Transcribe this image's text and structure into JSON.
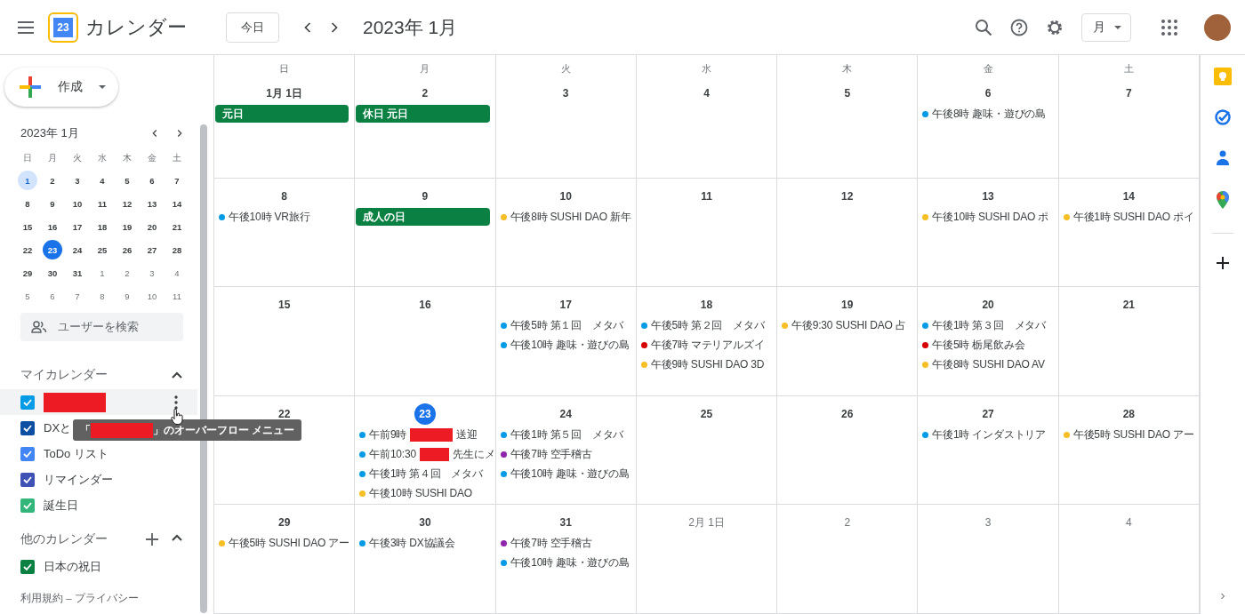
{
  "header": {
    "logo_day": "23",
    "app_name": "カレンダー",
    "today_button": "今日",
    "period": "2023年 1月",
    "view_select": "月"
  },
  "sidebar": {
    "create_label": "作成",
    "mini_calendar": {
      "title": "2023年 1月",
      "weekdays": [
        "日",
        "月",
        "火",
        "水",
        "木",
        "金",
        "土"
      ],
      "weeks": [
        [
          {
            "day": "1",
            "other_month": false,
            "selected": false,
            "highlighted": true
          },
          {
            "day": "2",
            "other_month": false,
            "selected": false,
            "highlighted": false
          },
          {
            "day": "3",
            "other_month": false,
            "selected": false,
            "highlighted": false
          },
          {
            "day": "4",
            "other_month": false,
            "selected": false,
            "highlighted": false
          },
          {
            "day": "5",
            "other_month": false,
            "selected": false,
            "highlighted": false
          },
          {
            "day": "6",
            "other_month": false,
            "selected": false,
            "highlighted": false
          },
          {
            "day": "7",
            "other_month": false,
            "selected": false,
            "highlighted": false
          }
        ],
        [
          {
            "day": "8",
            "other_month": false,
            "selected": false,
            "highlighted": false
          },
          {
            "day": "9",
            "other_month": false,
            "selected": false,
            "highlighted": false
          },
          {
            "day": "10",
            "other_month": false,
            "selected": false,
            "highlighted": false
          },
          {
            "day": "11",
            "other_month": false,
            "selected": false,
            "highlighted": false
          },
          {
            "day": "12",
            "other_month": false,
            "selected": false,
            "highlighted": false
          },
          {
            "day": "13",
            "other_month": false,
            "selected": false,
            "highlighted": false
          },
          {
            "day": "14",
            "other_month": false,
            "selected": false,
            "highlighted": false
          }
        ],
        [
          {
            "day": "15",
            "other_month": false,
            "selected": false,
            "highlighted": false
          },
          {
            "day": "16",
            "other_month": false,
            "selected": false,
            "highlighted": false
          },
          {
            "day": "17",
            "other_month": false,
            "selected": false,
            "highlighted": false
          },
          {
            "day": "18",
            "other_month": false,
            "selected": false,
            "highlighted": false
          },
          {
            "day": "19",
            "other_month": false,
            "selected": false,
            "highlighted": false
          },
          {
            "day": "20",
            "other_month": false,
            "selected": false,
            "highlighted": false
          },
          {
            "day": "21",
            "other_month": false,
            "selected": false,
            "highlighted": false
          }
        ],
        [
          {
            "day": "22",
            "other_month": false,
            "selected": false,
            "highlighted": false
          },
          {
            "day": "23",
            "other_month": false,
            "selected": true,
            "highlighted": false
          },
          {
            "day": "24",
            "other_month": false,
            "selected": false,
            "highlighted": false
          },
          {
            "day": "25",
            "other_month": false,
            "selected": false,
            "highlighted": false
          },
          {
            "day": "26",
            "other_month": false,
            "selected": false,
            "highlighted": false
          },
          {
            "day": "27",
            "other_month": false,
            "selected": false,
            "highlighted": false
          },
          {
            "day": "28",
            "other_month": false,
            "selected": false,
            "highlighted": false
          }
        ],
        [
          {
            "day": "29",
            "other_month": false,
            "selected": false,
            "highlighted": false
          },
          {
            "day": "30",
            "other_month": false,
            "selected": false,
            "highlighted": false
          },
          {
            "day": "31",
            "other_month": false,
            "selected": false,
            "highlighted": false
          },
          {
            "day": "1",
            "other_month": true,
            "selected": false,
            "highlighted": false
          },
          {
            "day": "2",
            "other_month": true,
            "selected": false,
            "highlighted": false
          },
          {
            "day": "3",
            "other_month": true,
            "selected": false,
            "highlighted": false
          },
          {
            "day": "4",
            "other_month": true,
            "selected": false,
            "highlighted": false
          }
        ],
        [
          {
            "day": "5",
            "other_month": true,
            "selected": false,
            "highlighted": false
          },
          {
            "day": "6",
            "other_month": true,
            "selected": false,
            "highlighted": false
          },
          {
            "day": "7",
            "other_month": true,
            "selected": false,
            "highlighted": false
          },
          {
            "day": "8",
            "other_month": true,
            "selected": false,
            "highlighted": false
          },
          {
            "day": "9",
            "other_month": true,
            "selected": false,
            "highlighted": false
          },
          {
            "day": "10",
            "other_month": true,
            "selected": false,
            "highlighted": false
          },
          {
            "day": "11",
            "other_month": true,
            "selected": false,
            "highlighted": false
          }
        ]
      ]
    },
    "user_search": {
      "placeholder": "ユーザーを検索"
    },
    "my_calendars": {
      "title": "マイカレンダー",
      "items": [
        {
          "redacted": true,
          "checked": true,
          "color": "#039be5",
          "hovered": true
        },
        {
          "label": "DXと",
          "checked": true,
          "color": "#0b4ea2",
          "hovered": false
        },
        {
          "label": "ToDo リスト",
          "checked": true,
          "color": "#4285f4",
          "hovered": false
        },
        {
          "label": "リマインダー",
          "checked": true,
          "color": "#3f51b5",
          "hovered": false
        },
        {
          "label": "誕生日",
          "checked": true,
          "color": "#33b679",
          "hovered": false
        }
      ]
    },
    "other_calendars": {
      "title": "他のカレンダー",
      "items": [
        {
          "label": "日本の祝日",
          "checked": true,
          "color": "#0b8043",
          "hovered": false
        }
      ]
    },
    "tooltip": {
      "before": "「",
      "after": "」のオーバーフロー メニュー"
    },
    "footer": "利用規約 – プライバシー"
  },
  "month": {
    "weekdays": [
      "日",
      "月",
      "火",
      "水",
      "木",
      "金",
      "土"
    ],
    "days": [
      {
        "date": "1月 1日",
        "muted": false,
        "today": false,
        "events": [
          {
            "kind": "allday",
            "text": "元日"
          }
        ]
      },
      {
        "date": "2",
        "muted": false,
        "today": false,
        "events": [
          {
            "kind": "allday",
            "text": "休日 元日"
          }
        ]
      },
      {
        "date": "3",
        "muted": false,
        "today": false
      },
      {
        "date": "4",
        "muted": false,
        "today": false
      },
      {
        "date": "5",
        "muted": false,
        "today": false
      },
      {
        "date": "6",
        "muted": false,
        "today": false,
        "events": [
          {
            "kind": "timed",
            "text": "午後8時 趣味・遊びの島",
            "color": "#039be5"
          }
        ]
      },
      {
        "date": "7",
        "muted": false,
        "today": false
      },
      {
        "date": "8",
        "muted": false,
        "today": false,
        "events": [
          {
            "kind": "timed",
            "text": "午後10時 VR旅行",
            "color": "#039be5"
          }
        ]
      },
      {
        "date": "9",
        "muted": false,
        "today": false,
        "events": [
          {
            "kind": "allday",
            "text": "成人の日"
          }
        ]
      },
      {
        "date": "10",
        "muted": false,
        "today": false,
        "events": [
          {
            "kind": "timed",
            "text": "午後8時 SUSHI DAO 新年",
            "color": "#f6bf26"
          }
        ]
      },
      {
        "date": "11",
        "muted": false,
        "today": false
      },
      {
        "date": "12",
        "muted": false,
        "today": false
      },
      {
        "date": "13",
        "muted": false,
        "today": false,
        "events": [
          {
            "kind": "timed",
            "text": "午後10時 SUSHI DAO ポ",
            "color": "#f6bf26"
          }
        ]
      },
      {
        "date": "14",
        "muted": false,
        "today": false,
        "events": [
          {
            "kind": "timed",
            "text": "午後1時 SUSHI DAO ポイ",
            "color": "#f6bf26"
          }
        ]
      },
      {
        "date": "15",
        "muted": false,
        "today": false
      },
      {
        "date": "16",
        "muted": false,
        "today": false
      },
      {
        "date": "17",
        "muted": false,
        "today": false,
        "events": [
          {
            "kind": "timed",
            "text": "午後5時 第１回　メタバ",
            "color": "#039be5"
          },
          {
            "kind": "timed",
            "text": "午後10時 趣味・遊びの島",
            "color": "#039be5"
          }
        ]
      },
      {
        "date": "18",
        "muted": false,
        "today": false,
        "events": [
          {
            "kind": "timed",
            "text": "午後5時 第２回　メタバ",
            "color": "#039be5"
          },
          {
            "kind": "timed",
            "text": "午後7時 マテリアルズイ",
            "color": "#d50000"
          },
          {
            "kind": "timed",
            "text": "午後9時 SUSHI DAO 3D",
            "color": "#f6bf26"
          }
        ]
      },
      {
        "date": "19",
        "muted": false,
        "today": false,
        "events": [
          {
            "kind": "timed",
            "text": "午後9:30 SUSHI DAO 占",
            "color": "#f6bf26"
          }
        ]
      },
      {
        "date": "20",
        "muted": false,
        "today": false,
        "events": [
          {
            "kind": "timed",
            "text": "午後1時 第３回　メタバ",
            "color": "#039be5"
          },
          {
            "kind": "timed",
            "text": "午後5時 栃尾飲み会",
            "color": "#d50000"
          },
          {
            "kind": "timed",
            "text": "午後8時 SUSHI DAO AV",
            "color": "#f6bf26"
          }
        ]
      },
      {
        "date": "21",
        "muted": false,
        "today": false
      },
      {
        "date": "22",
        "muted": false,
        "today": false
      },
      {
        "date": "23",
        "muted": false,
        "today": true,
        "events": [
          {
            "kind": "timed",
            "text": "午前9時",
            "text_after": "送迎",
            "color": "#039be5",
            "redacted": true
          },
          {
            "kind": "timed",
            "text": "午前10:30",
            "text_after": "先生にメ",
            "color": "#039be5",
            "redacted": true
          },
          {
            "kind": "timed",
            "text": "午後1時 第４回　メタバ",
            "color": "#039be5"
          },
          {
            "kind": "timed",
            "text": "午後10時 SUSHI DAO",
            "color": "#f6bf26"
          }
        ]
      },
      {
        "date": "24",
        "muted": false,
        "today": false,
        "events": [
          {
            "kind": "timed",
            "text": "午後1時 第５回　メタバ",
            "color": "#039be5"
          },
          {
            "kind": "timed",
            "text": "午後7時 空手稽古",
            "color": "#8e24aa"
          },
          {
            "kind": "timed",
            "text": "午後10時 趣味・遊びの島",
            "color": "#039be5"
          }
        ]
      },
      {
        "date": "25",
        "muted": false,
        "today": false
      },
      {
        "date": "26",
        "muted": false,
        "today": false
      },
      {
        "date": "27",
        "muted": false,
        "today": false,
        "events": [
          {
            "kind": "timed",
            "text": "午後1時 インダストリア",
            "color": "#039be5"
          }
        ]
      },
      {
        "date": "28",
        "muted": false,
        "today": false,
        "events": [
          {
            "kind": "timed",
            "text": "午後5時 SUSHI DAO アー",
            "color": "#f6bf26"
          }
        ]
      },
      {
        "date": "29",
        "muted": false,
        "today": false,
        "events": [
          {
            "kind": "timed",
            "text": "午後5時 SUSHI DAO アー",
            "color": "#f6bf26"
          }
        ]
      },
      {
        "date": "30",
        "muted": false,
        "today": false,
        "events": [
          {
            "kind": "timed",
            "text": "午後3時 DX協議会",
            "color": "#039be5"
          }
        ]
      },
      {
        "date": "31",
        "muted": false,
        "today": false,
        "events": [
          {
            "kind": "timed",
            "text": "午後7時 空手稽古",
            "color": "#8e24aa"
          },
          {
            "kind": "timed",
            "text": "午後10時 趣味・遊びの島",
            "color": "#039be5"
          }
        ]
      },
      {
        "date": "2月 1日",
        "muted": true,
        "today": false
      },
      {
        "date": "2",
        "muted": true,
        "today": false
      },
      {
        "date": "3",
        "muted": true,
        "today": false
      },
      {
        "date": "4",
        "muted": true,
        "today": false
      }
    ]
  }
}
